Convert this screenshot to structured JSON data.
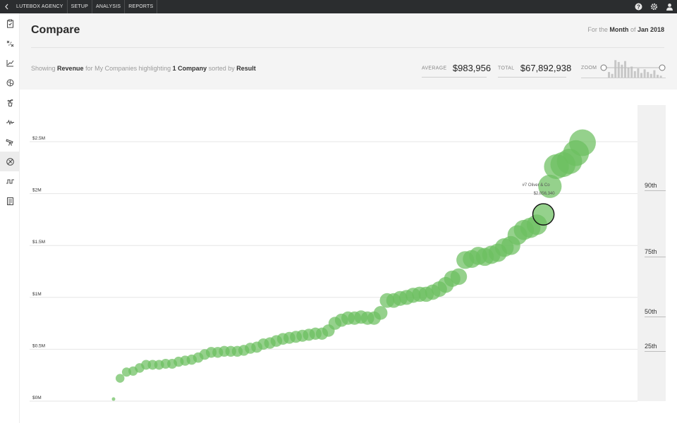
{
  "topbar": {
    "nav": [
      "LUTEBOX AGENCY",
      "SETUP",
      "ANALYSIS",
      "REPORTS"
    ]
  },
  "header": {
    "title": "Compare",
    "period": {
      "prefix": "For the",
      "unit": "Month",
      "of": "of",
      "date": "Jan 2018"
    },
    "showing": {
      "label": "Showing",
      "metric": "Revenue",
      "for_text": "for My Companies highlighting",
      "highlight": "1 Company",
      "sorted_text": "sorted by",
      "sort": "Result"
    },
    "stats": {
      "average_label": "AVERAGE",
      "average_value": "$983,956",
      "total_label": "TOTAL",
      "total_value": "$67,892,938"
    },
    "zoom_label": "ZOOM",
    "zoom_hist": [
      0.3,
      0.2,
      0.95,
      0.85,
      0.7,
      0.9,
      0.55,
      0.6,
      0.35,
      0.5,
      0.25,
      0.45,
      0.3,
      0.2,
      0.4,
      0.15,
      0.1
    ]
  },
  "colors": {
    "bubble": "#6cbf5f",
    "highlight_ring": "#111111"
  },
  "tooltip": {
    "name": "#7 Oliver & Co",
    "value": "$2,056,340"
  },
  "percentiles": [
    {
      "label": "90th",
      "value": 2.02
    },
    {
      "label": "75th",
      "value": 1.38
    },
    {
      "label": "50th",
      "value": 0.8
    },
    {
      "label": "25th",
      "value": 0.47
    }
  ],
  "chart_data": {
    "type": "scatter",
    "ylim": [
      0,
      2.5
    ],
    "yticks": [
      {
        "label": "$0M",
        "value": 0
      },
      {
        "label": "$0.5M",
        "value": 0.5
      },
      {
        "label": "$1M",
        "value": 1
      },
      {
        "label": "$1.5M",
        "value": 1.5
      },
      {
        "label": "$2M",
        "value": 2
      },
      {
        "label": "$2.5M",
        "value": 2.5
      }
    ],
    "highlight_rank": 7,
    "values": [
      0.02,
      0.22,
      0.28,
      0.29,
      0.32,
      0.35,
      0.35,
      0.35,
      0.36,
      0.36,
      0.38,
      0.39,
      0.4,
      0.42,
      0.45,
      0.47,
      0.47,
      0.48,
      0.48,
      0.48,
      0.49,
      0.51,
      0.52,
      0.55,
      0.56,
      0.58,
      0.6,
      0.61,
      0.62,
      0.63,
      0.64,
      0.65,
      0.65,
      0.68,
      0.75,
      0.78,
      0.8,
      0.8,
      0.81,
      0.8,
      0.8,
      0.85,
      0.97,
      0.97,
      0.99,
      1.0,
      1.02,
      1.03,
      1.03,
      1.05,
      1.08,
      1.12,
      1.18,
      1.2,
      1.36,
      1.37,
      1.4,
      1.39,
      1.41,
      1.43,
      1.48,
      1.5,
      1.6,
      1.65,
      1.67,
      1.7,
      1.8,
      2.07,
      2.26,
      2.28,
      2.31,
      2.39,
      2.49
    ]
  }
}
